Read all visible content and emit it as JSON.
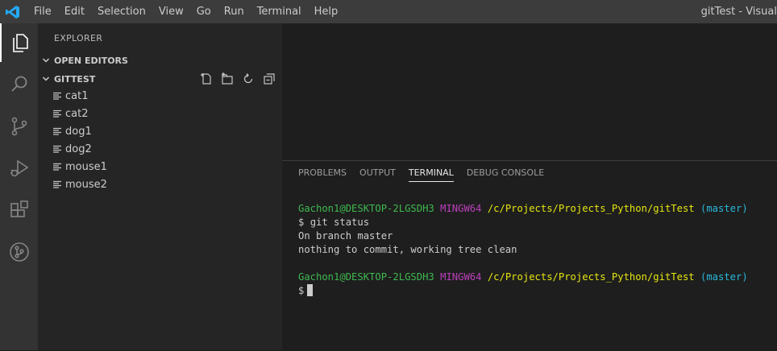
{
  "menu": [
    "File",
    "Edit",
    "Selection",
    "View",
    "Go",
    "Run",
    "Terminal",
    "Help"
  ],
  "window_title": "gitTest - Visual",
  "sidebar": {
    "title": "EXPLORER",
    "open_editors": "OPEN EDITORS",
    "folder": "GITTEST",
    "files": [
      "cat1",
      "cat2",
      "dog1",
      "dog2",
      "mouse1",
      "mouse2"
    ]
  },
  "panel": {
    "tabs": [
      "PROBLEMS",
      "OUTPUT",
      "TERMINAL",
      "DEBUG CONSOLE"
    ],
    "active_tab": "TERMINAL"
  },
  "terminal": {
    "user_host": "Gachon1@DESKTOP-2LGSDH3",
    "env": "MINGW64",
    "path": "/c/Projects/Projects_Python/gitTest",
    "branch": "(master)",
    "prompt": "$",
    "command": "git status",
    "output_line1": "On branch master",
    "output_line2": "nothing to commit, working tree clean"
  },
  "colors": {
    "user_host": "#3fb950",
    "env": "#bc3fbc",
    "path": "#e5e510",
    "branch": "#29b8db"
  }
}
